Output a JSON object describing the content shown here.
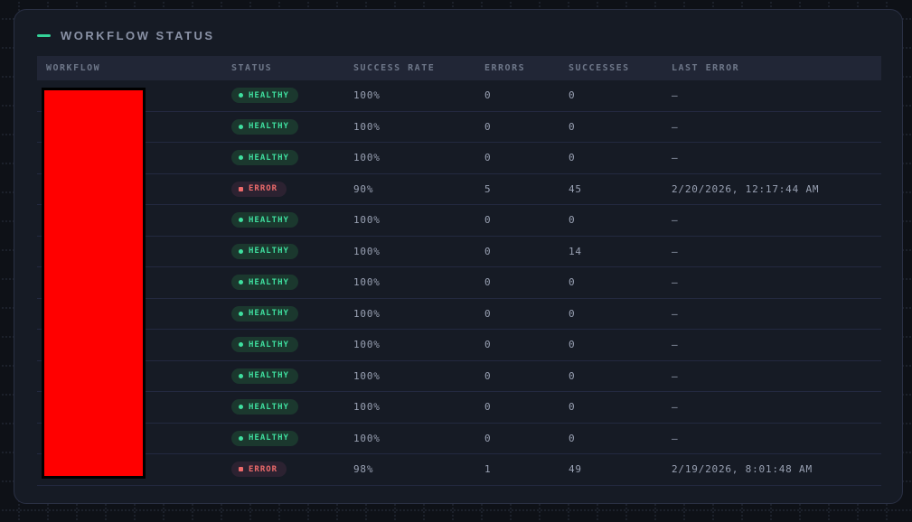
{
  "panel": {
    "title": "WORKFLOW STATUS"
  },
  "colors": {
    "accent_green": "#34d399",
    "healthy_text": "#3fdf9f",
    "error_text": "#ee6b6b",
    "redaction_fill": "#ff0000",
    "card_bg": "#161b25",
    "header_row_bg": "#212636"
  },
  "table": {
    "columns": [
      "WORKFLOW",
      "STATUS",
      "SUCCESS RATE",
      "ERRORS",
      "SUCCESSES",
      "LAST ERROR"
    ],
    "rows": [
      {
        "workflow": "",
        "status": "HEALTHY",
        "success_rate": "100%",
        "errors": "0",
        "successes": "0",
        "last_error": "—"
      },
      {
        "workflow": "",
        "status": "HEALTHY",
        "success_rate": "100%",
        "errors": "0",
        "successes": "0",
        "last_error": "—"
      },
      {
        "workflow": "",
        "status": "HEALTHY",
        "success_rate": "100%",
        "errors": "0",
        "successes": "0",
        "last_error": "—"
      },
      {
        "workflow": "",
        "status": "ERROR",
        "success_rate": "90%",
        "errors": "5",
        "successes": "45",
        "last_error": "2/20/2026, 12:17:44 AM"
      },
      {
        "workflow": "",
        "status": "HEALTHY",
        "success_rate": "100%",
        "errors": "0",
        "successes": "0",
        "last_error": "—"
      },
      {
        "workflow": "",
        "status": "HEALTHY",
        "success_rate": "100%",
        "errors": "0",
        "successes": "14",
        "last_error": "—"
      },
      {
        "workflow": "",
        "status": "HEALTHY",
        "success_rate": "100%",
        "errors": "0",
        "successes": "0",
        "last_error": "—"
      },
      {
        "workflow": "",
        "status": "HEALTHY",
        "success_rate": "100%",
        "errors": "0",
        "successes": "0",
        "last_error": "—"
      },
      {
        "workflow": "",
        "status": "HEALTHY",
        "success_rate": "100%",
        "errors": "0",
        "successes": "0",
        "last_error": "—"
      },
      {
        "workflow": "",
        "status": "HEALTHY",
        "success_rate": "100%",
        "errors": "0",
        "successes": "0",
        "last_error": "—"
      },
      {
        "workflow": "",
        "status": "HEALTHY",
        "success_rate": "100%",
        "errors": "0",
        "successes": "0",
        "last_error": "—"
      },
      {
        "workflow": "",
        "status": "HEALTHY",
        "success_rate": "100%",
        "errors": "0",
        "successes": "0",
        "last_error": "—"
      },
      {
        "workflow": "",
        "status": "ERROR",
        "success_rate": "98%",
        "errors": "1",
        "successes": "49",
        "last_error": "2/19/2026, 8:01:48 AM"
      }
    ]
  }
}
